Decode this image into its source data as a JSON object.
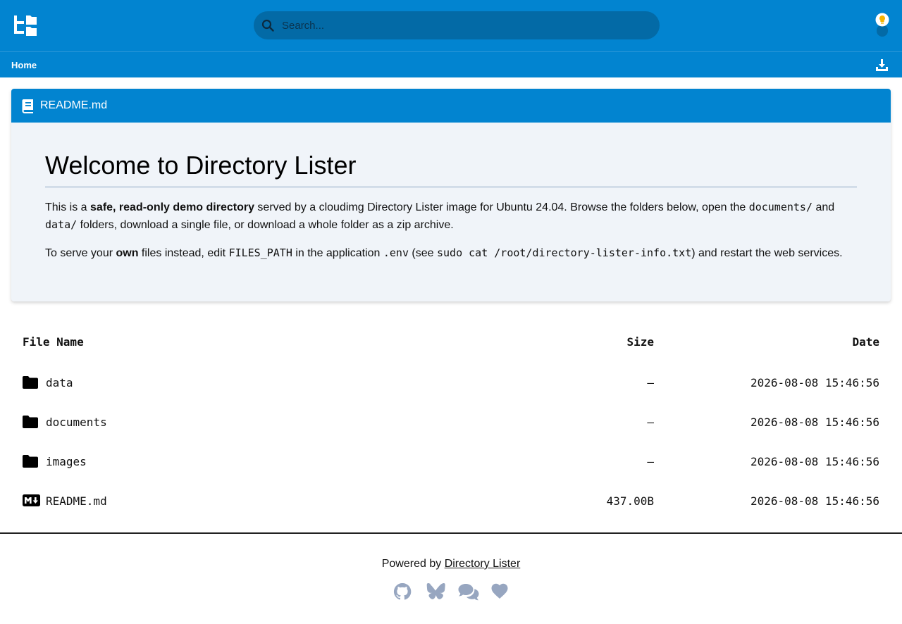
{
  "header": {
    "search_placeholder": "Search...",
    "logo_icon": "folder-tree-icon",
    "theme_icon": "lightbulb-toggle-icon"
  },
  "breadcrumb": {
    "home": "Home",
    "download_icon": "download-icon"
  },
  "readme": {
    "filename": "README.md",
    "heading": "Welcome to Directory Lister",
    "p1_a": "This is a ",
    "p1_bold": "safe, read-only demo directory",
    "p1_b": " served by a cloudimg Directory Lister image for Ubuntu 24.04. Browse the folders below, open the ",
    "p1_code1": "documents/",
    "p1_c": " and ",
    "p1_code2": "data/",
    "p1_d": " folders, download a single file, or download a whole folder as a zip archive.",
    "p2_a": "To serve your ",
    "p2_bold": "own",
    "p2_b": " files instead, edit ",
    "p2_code1": "FILES_PATH",
    "p2_c": " in the application ",
    "p2_code2": ".env",
    "p2_d": " (see ",
    "p2_code3": "sudo cat /root/directory-lister-info.txt",
    "p2_e": ") and restart the web services."
  },
  "table": {
    "headers": {
      "name": "File Name",
      "size": "Size",
      "date": "Date"
    },
    "rows": [
      {
        "name": "data",
        "size": "—",
        "date": "2026-08-08 15:46:56",
        "icon": "folder-icon"
      },
      {
        "name": "documents",
        "size": "—",
        "date": "2026-08-08 15:46:56",
        "icon": "folder-icon"
      },
      {
        "name": "images",
        "size": "—",
        "date": "2026-08-08 15:46:56",
        "icon": "folder-icon"
      },
      {
        "name": "README.md",
        "size": "437.00B",
        "date": "2026-08-08 15:46:56",
        "icon": "markdown-icon"
      }
    ]
  },
  "footer": {
    "powered_by": "Powered by",
    "link": "Directory Lister",
    "icons": [
      "github-icon",
      "bluesky-icon",
      "comments-icon",
      "heart-icon"
    ]
  },
  "colors": {
    "primary": "#0284d0",
    "search_bg": "#036aa6",
    "card_bg": "#f0f4f9",
    "social_icon": "#97a6c0"
  }
}
